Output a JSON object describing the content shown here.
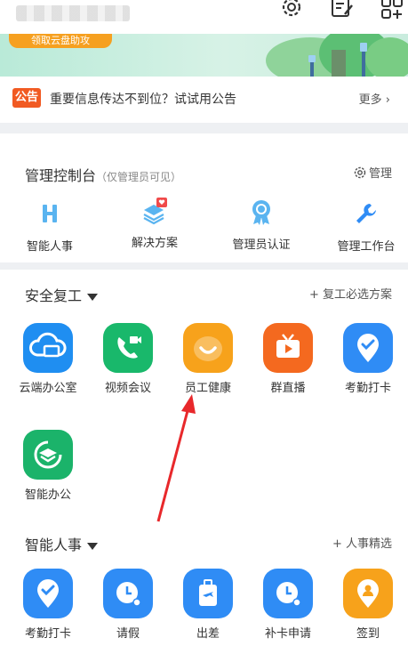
{
  "topbar": {
    "icons": [
      "gear-icon",
      "edit-list-icon",
      "add-app-icon"
    ]
  },
  "banner": {
    "button_label": "领取云盘助攻",
    "colors": {
      "button": "#f6a020",
      "background": "#c9ecde"
    }
  },
  "notice": {
    "badge": "公告",
    "text": "重要信息传达不到位？试试用公告",
    "more": "更多 ›"
  },
  "admin": {
    "title": "管理控制台",
    "subtitle": "（仅管理员可见）",
    "manage_label": "管理",
    "items": [
      {
        "label": "智能人事",
        "icon": "h-letter-icon"
      },
      {
        "label": "解决方案",
        "icon": "layers-heart-icon"
      },
      {
        "label": "管理员认证",
        "icon": "badge-ribbon-icon"
      },
      {
        "label": "管理工作台",
        "icon": "wrench-icon"
      }
    ]
  },
  "safe_return": {
    "title": "安全复工",
    "link": "+ 复工必选方案",
    "apps": [
      {
        "label": "云端办公室",
        "icon": "cloud-desktop-icon",
        "color": "#1f8ef1"
      },
      {
        "label": "视频会议",
        "icon": "video-call-icon",
        "color": "#19b86b"
      },
      {
        "label": "员工健康",
        "icon": "smile-heart-icon",
        "color": "#f7a21b"
      },
      {
        "label": "群直播",
        "icon": "tv-live-icon",
        "color": "#f4691f"
      },
      {
        "label": "考勤打卡",
        "icon": "location-check-icon",
        "color": "#2f8cf5"
      },
      {
        "label": "智能办公",
        "icon": "smart-office-icon",
        "color": "#1bb36a"
      }
    ]
  },
  "hr": {
    "title": "智能人事",
    "link": "+ 人事精选",
    "apps": [
      {
        "label": "考勤打卡",
        "icon": "location-check-icon",
        "color": "#2f8cf5"
      },
      {
        "label": "请假",
        "icon": "clock-person-icon",
        "color": "#2f8cf5"
      },
      {
        "label": "出差",
        "icon": "luggage-plane-icon",
        "color": "#2f8cf5"
      },
      {
        "label": "补卡申请",
        "icon": "clock-person-icon",
        "color": "#2f8cf5"
      },
      {
        "label": "签到",
        "icon": "location-person-icon",
        "color": "#f7a21b"
      }
    ]
  }
}
